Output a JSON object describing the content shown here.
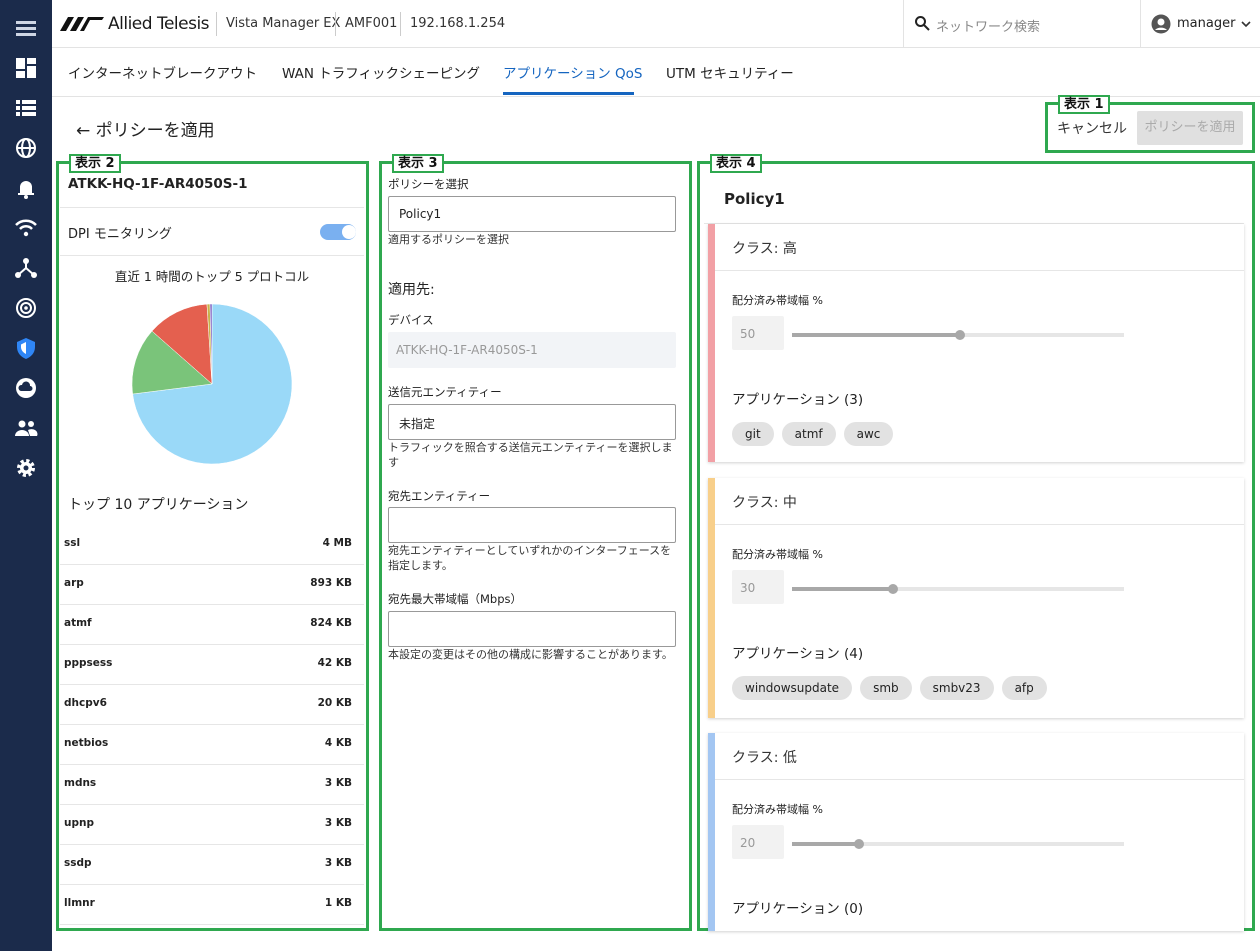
{
  "header": {
    "brand": "Allied Telesis",
    "product": "Vista Manager EX",
    "device": "AMF001",
    "ip": "192.168.1.254",
    "search_placeholder": "ネットワーク検索",
    "user": "manager"
  },
  "tabs": [
    {
      "label": "インターネットブレークアウト",
      "active": false
    },
    {
      "label": "WAN トラフィックシェーピング",
      "active": false
    },
    {
      "label": "アプリケーション QoS",
      "active": true
    },
    {
      "label": "UTM セキュリティー",
      "active": false
    }
  ],
  "page": {
    "title": "ポリシーを適用",
    "cancel": "キャンセル",
    "apply": "ポリシーを適用"
  },
  "annotations": [
    "表示 1",
    "表示 2",
    "表示 3",
    "表示 4"
  ],
  "device_panel": {
    "name": "ATKK-HQ-1F-AR4050S-1",
    "dpi_label": "DPI モニタリング",
    "dpi_enabled": true,
    "pie_title": "直近 1 時間のトップ 5 プロトコル",
    "top10_title": "トップ 10 アプリケーション",
    "apps": [
      {
        "name": "ssl",
        "size": "4 MB"
      },
      {
        "name": "arp",
        "size": "893 KB"
      },
      {
        "name": "atmf",
        "size": "824 KB"
      },
      {
        "name": "pppsess",
        "size": "42 KB"
      },
      {
        "name": "dhcpv6",
        "size": "20 KB"
      },
      {
        "name": "netbios",
        "size": "4 KB"
      },
      {
        "name": "mdns",
        "size": "3 KB"
      },
      {
        "name": "upnp",
        "size": "3 KB"
      },
      {
        "name": "ssdp",
        "size": "3 KB"
      },
      {
        "name": "llmnr",
        "size": "1 KB"
      }
    ]
  },
  "chart_data": {
    "type": "pie",
    "title": "直近 1 時間のトップ 5 プロトコル",
    "values": [
      73,
      13.5,
      12.5,
      0.6,
      0.4
    ],
    "colors": [
      "#9ad9f8",
      "#7ac47a",
      "#e4604f",
      "#c8b24a",
      "#7a5fc0"
    ]
  },
  "form": {
    "policy_label": "ポリシーを選択",
    "policy_value": "Policy1",
    "policy_help": "適用するポリシーを選択",
    "dest_header": "適用先:",
    "device_label": "デバイス",
    "device_value": "ATKK-HQ-1F-AR4050S-1",
    "source_label": "送信元エンティティー",
    "source_value": "未指定",
    "source_help": "トラフィックを照合する送信元エンティティーを選択します",
    "dest_label": "宛先エンティティー",
    "dest_value": "",
    "dest_help": "宛先エンティティーとしていずれかのインターフェースを指定します。",
    "bw_label": "宛先最大帯域幅（Mbps）",
    "bw_value": "",
    "bw_help": "本設定の変更はその他の構成に影響することがあります。"
  },
  "policy": {
    "name": "Policy1",
    "classes": [
      {
        "title": "クラス: 高",
        "bw_label": "配分済み帯域幅 %",
        "bw": "50",
        "bw_fraction": 0.5,
        "apps_label": "アプリケーション (3)",
        "apps": [
          "git",
          "atmf",
          "awc"
        ],
        "color": "#f2a0a5"
      },
      {
        "title": "クラス: 中",
        "bw_label": "配分済み帯域幅 %",
        "bw": "30",
        "bw_fraction": 0.3,
        "apps_label": "アプリケーション (4)",
        "apps": [
          "windowsupdate",
          "smb",
          "smbv23",
          "afp"
        ],
        "color": "#f8cf8a"
      },
      {
        "title": "クラス: 低",
        "bw_label": "配分済み帯域幅 %",
        "bw": "20",
        "bw_fraction": 0.2,
        "apps_label": "アプリケーション (0)",
        "apps": [],
        "color": "#a3c6f2"
      }
    ]
  }
}
